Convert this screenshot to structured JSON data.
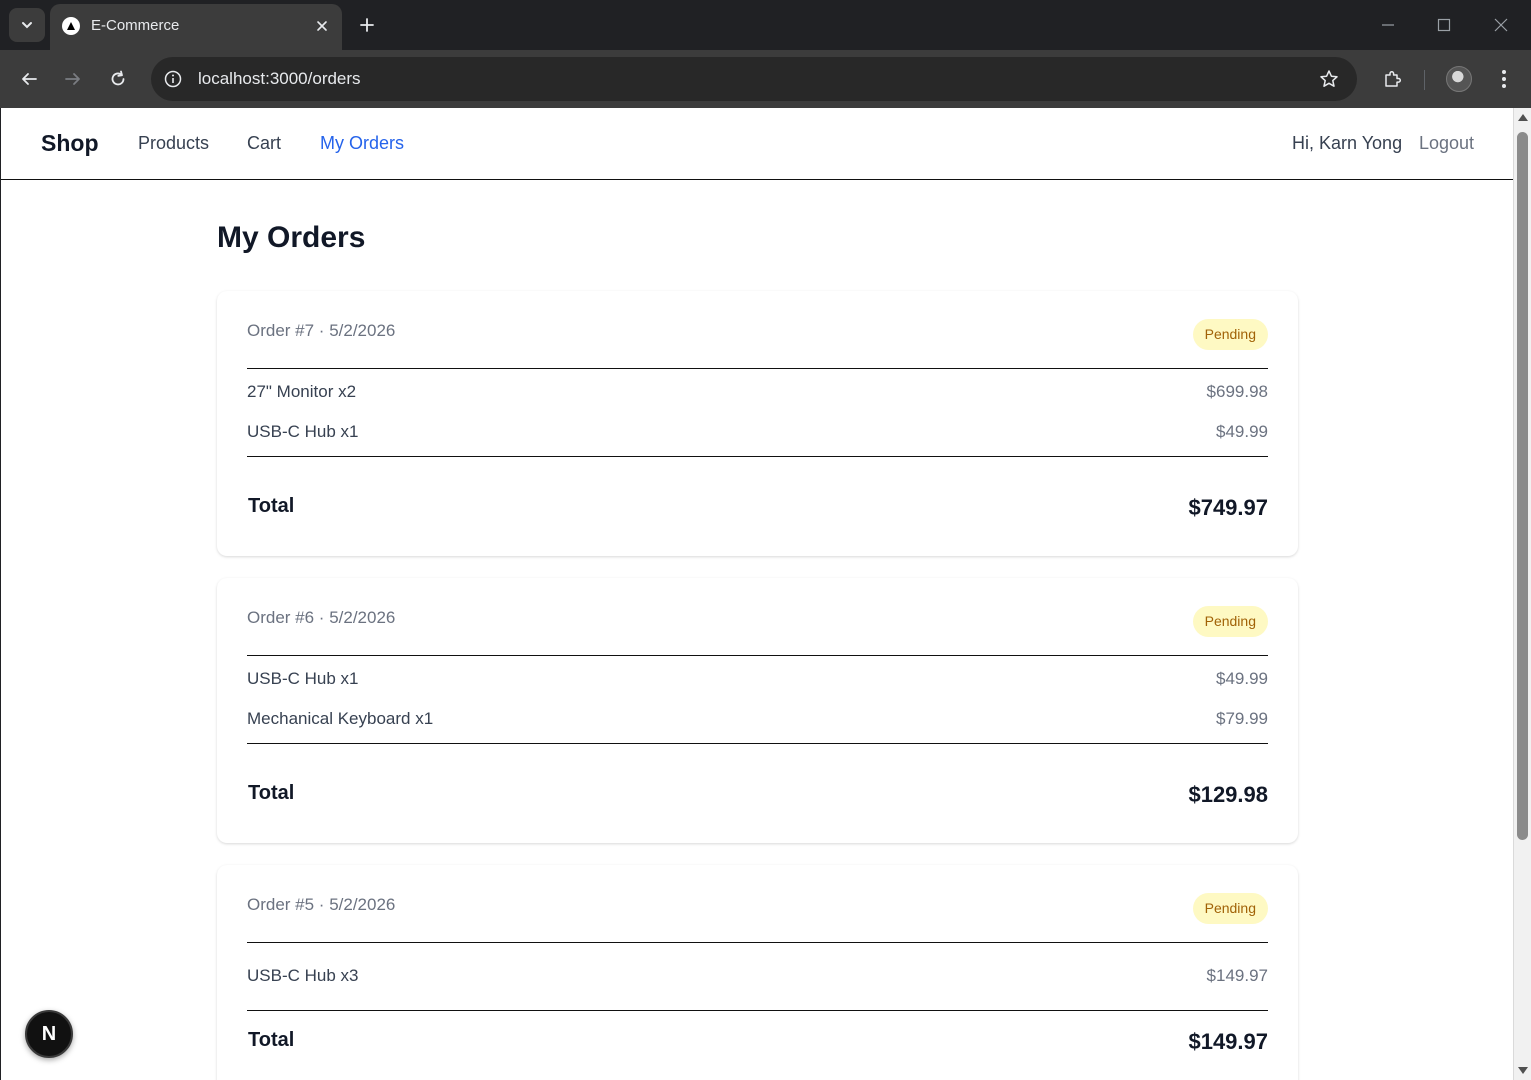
{
  "browser": {
    "tab_title": "E-Commerce",
    "url": "localhost:3000/orders"
  },
  "site": {
    "brand": "Shop",
    "nav": [
      "Products",
      "Cart",
      "My Orders"
    ],
    "active_nav": "My Orders",
    "greeting": "Hi, Karn Yong",
    "logout": "Logout"
  },
  "page": {
    "title": "My Orders",
    "total_label": "Total"
  },
  "orders": [
    {
      "meta": "Order #7 · 5/2/2026",
      "status": "Pending",
      "items": [
        {
          "name": "27\" Monitor x2",
          "price": "$699.98"
        },
        {
          "name": "USB-C Hub x1",
          "price": "$49.99"
        }
      ],
      "total": "$749.97"
    },
    {
      "meta": "Order #6 · 5/2/2026",
      "status": "Pending",
      "items": [
        {
          "name": "USB-C Hub x1",
          "price": "$49.99"
        },
        {
          "name": "Mechanical Keyboard x1",
          "price": "$79.99"
        }
      ],
      "total": "$129.98"
    },
    {
      "meta": "Order #5 · 5/2/2026",
      "status": "Pending",
      "items": [
        {
          "name": "USB-C Hub x3",
          "price": "$149.97"
        }
      ],
      "total": "$149.97"
    }
  ],
  "dev_badge": "N",
  "colors": {
    "accent": "#2563eb",
    "badge_bg": "#fef9c3",
    "badge_text": "#a16207"
  },
  "icons": [
    "chevron-down-icon",
    "close-icon",
    "plus-icon",
    "back-icon",
    "forward-icon",
    "reload-icon",
    "info-icon",
    "star-icon",
    "extensions-icon",
    "kebab-menu-icon",
    "minimize-icon",
    "maximize-icon"
  ]
}
